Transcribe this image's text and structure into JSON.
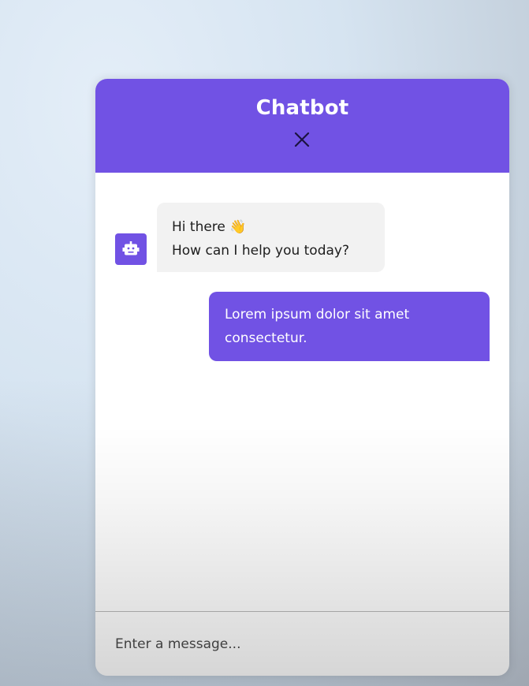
{
  "chatbot": {
    "title": "Chatbot",
    "close_icon": "close-icon",
    "accent_color": "#7152e4"
  },
  "messages": [
    {
      "role": "incoming",
      "avatar_icon": "robot-icon",
      "lines": [
        "Hi there",
        "How can I help you today?"
      ],
      "emoji": "👋"
    },
    {
      "role": "outgoing",
      "lines": [
        "Lorem ipsum dolor sit amet",
        "consectetur."
      ]
    }
  ],
  "input": {
    "placeholder": "Enter a message...",
    "value": ""
  }
}
